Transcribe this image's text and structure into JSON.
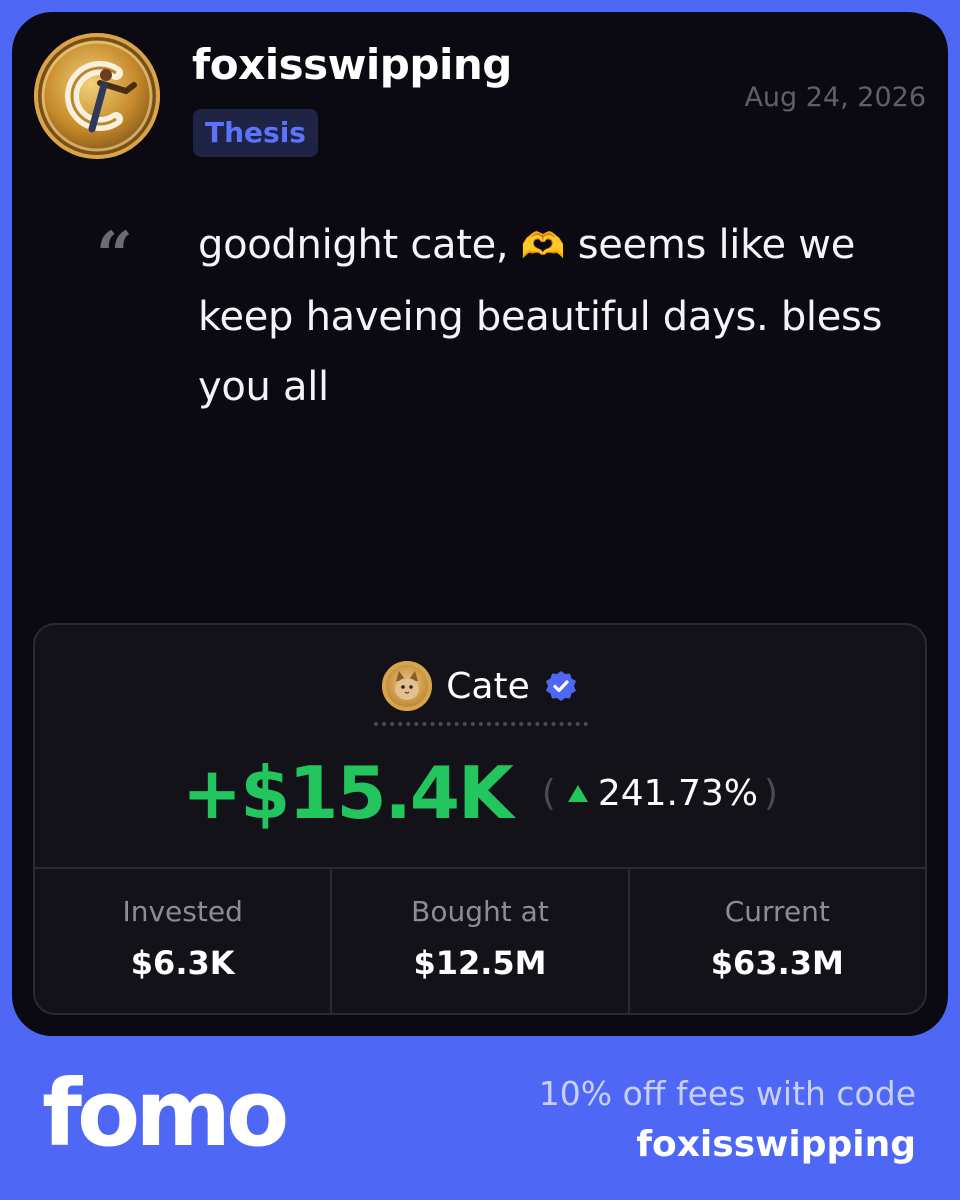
{
  "post": {
    "username": "foxisswipping",
    "tag": "Thesis",
    "date": "Aug 24, 2026",
    "quote_mark": "“",
    "quote_line1_pre": "goodnight cate, ",
    "quote_emoji": "🫶",
    "quote_line1_post": " seems like",
    "quote_rest": "we keep haveing beautiful days. bless you all"
  },
  "trade": {
    "token_name": "Cate",
    "verified_icon": "verified-badge-icon",
    "pnl": "+$15.4K",
    "paren_open": "(",
    "pnl_percent": "241.73%",
    "paren_close": ")",
    "stats": [
      {
        "label": "Invested",
        "value": "$6.3K"
      },
      {
        "label": "Bought at",
        "value": "$12.5M"
      },
      {
        "label": "Current",
        "value": "$63.3M"
      }
    ]
  },
  "footer": {
    "brand": "fomo",
    "promo_text": "10% off fees with code",
    "promo_code": "foxisswipping"
  },
  "colors": {
    "background": "#4f67f5",
    "card": "#0b0a13",
    "accent_blue": "#5b73ff",
    "profit_green": "#22c55e"
  }
}
